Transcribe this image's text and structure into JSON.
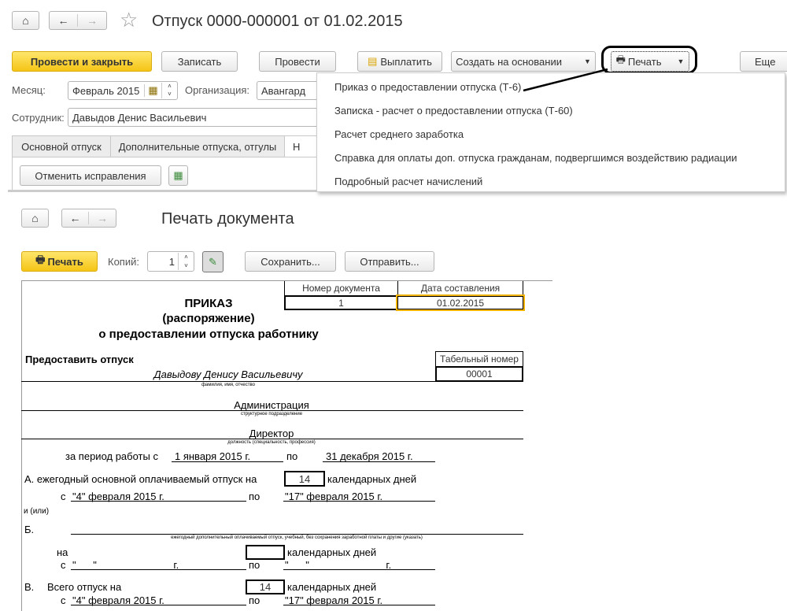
{
  "doc_form": {
    "title": "Отпуск 0000-000001 от 01.02.2015",
    "toolbar": {
      "post_close": "Провести и закрыть",
      "save": "Записать",
      "post": "Провести",
      "pay": "Выплатить",
      "create_based": "Создать на основании",
      "print": "Печать",
      "more": "Еще"
    },
    "month_label": "Месяц:",
    "month_value": "Февраль 2015",
    "org_label": "Организация:",
    "org_value": "Авангард",
    "employee_label": "Сотрудник:",
    "employee_value": "Давыдов Денис Васильевич",
    "tabs": [
      "Основной отпуск",
      "Дополнительные отпуска, отгулы",
      "Н"
    ],
    "cancel_corrections": "Отменить исправления",
    "print_menu": [
      "Приказ о предоставлении отпуска (Т-6)",
      "Записка - расчет о предоставлении отпуска (Т-60)",
      "Расчет среднего заработка",
      "Справка для оплаты доп. отпуска гражданам, подвергшимся воздействию радиации",
      "Подробный расчет начислений"
    ]
  },
  "print_form": {
    "title": "Печать документа",
    "print": "Печать",
    "copies_label": "Копий:",
    "copies_value": "1",
    "save": "Сохранить...",
    "send": "Отправить..."
  },
  "document": {
    "doc_number_header": "Номер документа",
    "doc_date_header": "Дата составления",
    "doc_number": "1",
    "doc_date": "01.02.2015",
    "heading1": "ПРИКАЗ",
    "heading2": "(распоряжение)",
    "heading3": "о предоставлении отпуска работнику",
    "grant_leave": "Предоставить отпуск",
    "tab_number_header": "Табельный номер",
    "tab_number": "00001",
    "employee": "Давыдову Денису Васильевичу",
    "employee_caption": "фамилия, имя, отчество",
    "department": "Администрация",
    "department_caption": "структурное подразделение",
    "position": "Директор",
    "position_caption": "должность (специальность, профессия)",
    "period_label": "за период работы с",
    "period_from": "1 января 2015 г.",
    "to": "по",
    "period_to": "31 декабря 2015 г.",
    "a_label": "А. ежегодный основной оплачиваемый отпуск на",
    "a_days": "14",
    "days_label": "календарных дней",
    "from": "с",
    "a_from": "\"4\" февраля 2015 г.",
    "a_to": "\"17\" февраля 2015 г.",
    "and_or": "и (или)",
    "b_label": "Б.",
    "b_caption": "ежегодный дополнительный оплачиваемый отпуск, учебный, без сохранения заработной платы и другие (указать)",
    "na": "на",
    "empty_date_from": "\"      \"                           г.",
    "empty_date_to": "\"      \"                           г.",
    "v_label": "В.",
    "v_text": "Всего отпуск на",
    "v_days": "14",
    "v_from": "\"4\" февраля 2015 г.",
    "v_to": "\"17\" февраля 2015 г."
  }
}
